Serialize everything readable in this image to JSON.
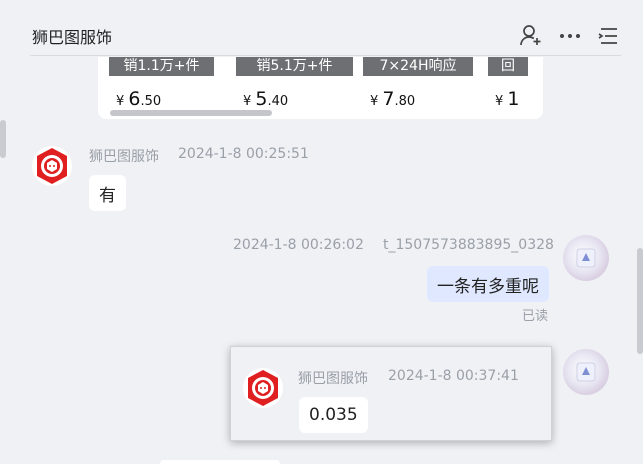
{
  "header": {
    "title": "狮巴图服饰",
    "icons": [
      "add-user-icon",
      "more-icon",
      "menu-list-icon"
    ]
  },
  "product_strip": {
    "items": [
      {
        "banner": "销1.1万+件",
        "currency": "¥",
        "price_int": "6",
        "price_dec": ".50"
      },
      {
        "banner": "销5.1万+件",
        "currency": "¥",
        "price_int": "5",
        "price_dec": ".40"
      },
      {
        "banner": "7×24H响应",
        "currency": "¥",
        "price_int": "7",
        "price_dec": ".80"
      },
      {
        "banner": "回",
        "currency": "¥",
        "price_int": "1",
        "price_dec": ""
      }
    ]
  },
  "messages": [
    {
      "sender": "狮巴图服饰",
      "time": "2024-1-8 00:25:51",
      "text": "有",
      "side": "left"
    },
    {
      "sender": "t_1507573883895_0328",
      "time": "2024-1-8 00:26:02",
      "text": "一条有多重呢",
      "side": "right",
      "status": "已读"
    },
    {
      "sender": "狮巴图服饰",
      "time": "2024-1-8 00:37:41",
      "text": "0.035",
      "side": "quoted"
    }
  ],
  "colors": {
    "background": "#f0f1f5",
    "bubble_mine": "#dfe8ff",
    "bubble_theirs": "#ffffff",
    "shop_logo_red": "#e02020"
  }
}
